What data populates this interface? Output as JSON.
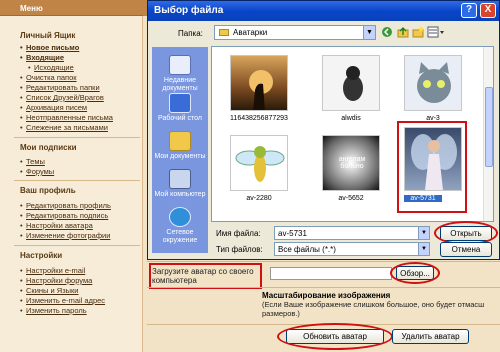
{
  "sidebar": {
    "header": "Меню",
    "sections": [
      {
        "title": "Личный Ящик",
        "items": [
          {
            "label": "Новое письмо",
            "bold": true
          },
          {
            "label": "Входящие",
            "bold": true
          },
          {
            "label": "Исходящие",
            "bold": false
          },
          {
            "label": "Очистка папок",
            "bold": false
          },
          {
            "label": "Редактировать папки",
            "bold": false
          },
          {
            "label": "Список Друзей/Врагов",
            "bold": false
          },
          {
            "label": "Архивация писем",
            "bold": false
          },
          {
            "label": "Неотправленные письма",
            "bold": false
          },
          {
            "label": "Слежение за письмами",
            "bold": false
          }
        ]
      },
      {
        "title": "Мои подписки",
        "items": [
          {
            "label": "Темы",
            "bold": false
          },
          {
            "label": "Форумы",
            "bold": false
          }
        ]
      },
      {
        "title": "Ваш профиль",
        "items": [
          {
            "label": "Редактировать профиль",
            "bold": false
          },
          {
            "label": "Редактировать подпись",
            "bold": false
          },
          {
            "label": "Настройки аватара",
            "bold": false
          },
          {
            "label": "Изменение фотографии",
            "bold": false
          }
        ]
      },
      {
        "title": "Настройки",
        "items": [
          {
            "label": "Настройки e-mail",
            "bold": false
          },
          {
            "label": "Настройки форума",
            "bold": false
          },
          {
            "label": "Скины и Языки",
            "bold": false
          },
          {
            "label": "Изменить e-mail адрес",
            "bold": false
          },
          {
            "label": "Изменить пароль",
            "bold": false
          }
        ]
      }
    ]
  },
  "dialog": {
    "title": "Выбор файла",
    "folder_label": "Папка:",
    "folder_value": "Аватарки",
    "places": [
      "Недавние документы",
      "Рабочий стол",
      "Мои документы",
      "Мой компьютер",
      "Сетевое окружение"
    ],
    "files": [
      {
        "name": "116438256877293"
      },
      {
        "name": "alwdis"
      },
      {
        "name": "av-3"
      },
      {
        "name": "av-2280"
      },
      {
        "name": "av-5652"
      },
      {
        "name": "av-5731",
        "selected": true
      }
    ],
    "thumb_text": "ангелам больно",
    "filename_label": "Имя файла:",
    "filename_value": "av-5731",
    "filetype_label": "Тип файлов:",
    "filetype_value": "Все файлы (*.*)",
    "open_button": "Открыть",
    "cancel_button": "Отмена",
    "help_button": "?",
    "close_button": "X"
  },
  "form": {
    "upload_label": "Загрузите аватар со своего компьютера",
    "browse_button": "Обзор...",
    "scale_heading": "Масштабирование изображения",
    "scale_note": "(Если Ваше изображение слишком большое, оно будет отмасш размеров.)",
    "update_button": "Обновить аватар",
    "delete_button": "Удалить аватар"
  },
  "colors": {
    "highlight": "#d01010",
    "title_blue": "#0a45c9",
    "forum_brown": "#c08447"
  }
}
